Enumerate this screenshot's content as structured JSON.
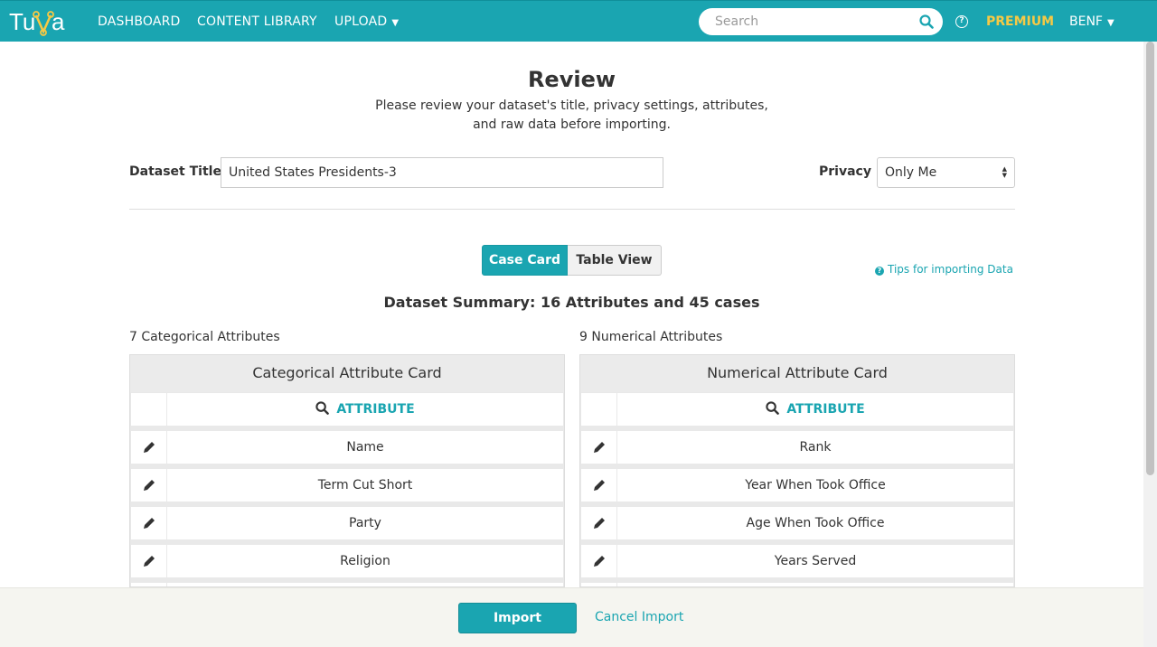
{
  "nav": {
    "logo_text": "Tuva",
    "dashboard": "DASHBOARD",
    "content_library": "CONTENT LIBRARY",
    "upload": "UPLOAD",
    "search_placeholder": "Search",
    "premium": "PREMIUM",
    "user": "BENF"
  },
  "page": {
    "title": "Review",
    "subtitle_line1": "Please review your dataset's title, privacy settings, attributes,",
    "subtitle_line2": "and raw data before importing."
  },
  "form": {
    "dataset_title_label": "Dataset Title",
    "dataset_title_value": "United States Presidents-3",
    "privacy_label": "Privacy",
    "privacy_value": "Only Me"
  },
  "view_toggle": {
    "case_card": "Case Card",
    "table_view": "Table View",
    "active": "Case Card"
  },
  "tips_link": "Tips for importing Data",
  "summary": "Dataset Summary: 16 Attributes and 45 cases",
  "categorical": {
    "count_label": "7 Categorical Attributes",
    "card_title": "Categorical Attribute Card",
    "column_header": "ATTRIBUTE",
    "rows": [
      "Name",
      "Term Cut Short",
      "Party",
      "Religion"
    ]
  },
  "numerical": {
    "count_label": "9 Numerical Attributes",
    "card_title": "Numerical Attribute Card",
    "column_header": "ATTRIBUTE",
    "rows": [
      "Rank",
      "Year When Took Office",
      "Age When Took Office",
      "Years Served"
    ]
  },
  "footer": {
    "import": "Import",
    "cancel": "Cancel Import"
  },
  "colors": {
    "accent": "#1aa5b1",
    "premium": "#f7c944"
  },
  "icons": [
    "search-icon",
    "help-icon",
    "pencil-icon",
    "question-circle-icon"
  ]
}
